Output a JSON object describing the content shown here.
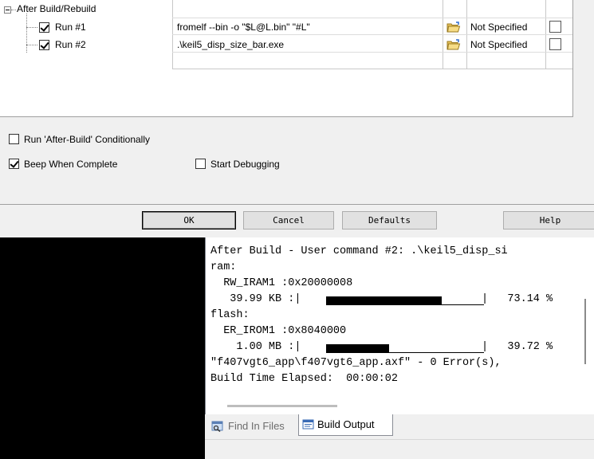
{
  "tree": {
    "group_label": "After Build/Rebuild",
    "rows": [
      {
        "label": "Run #1",
        "checked": true,
        "command": "fromelf --bin -o \"$L@L.bin\" \"#L\"",
        "dos16": "Not Specified"
      },
      {
        "label": "Run #2",
        "checked": true,
        "command": ".\\keil5_disp_size_bar.exe",
        "dos16": "Not Specified"
      }
    ]
  },
  "options": {
    "run_conditionally": "Run 'After-Build' Conditionally",
    "beep_when_complete": "Beep When Complete",
    "start_debugging": "Start Debugging"
  },
  "buttons": {
    "ok": "OK",
    "cancel": "Cancel",
    "defaults": "Defaults",
    "help": "Help"
  },
  "build_output": {
    "lines": [
      "After Build - User command #2: .\\keil5_disp_si",
      "ram:",
      "  RW_IRAM1 :0x20000008",
      "   39.99 KB :|",
      "flash:",
      "  ER_IROM1 :0x8040000",
      "    1.00 MB :|",
      "\"f407vgt6_app\\f407vgt6_app.axf\" - 0 Error(s),",
      "Build Time Elapsed:  00:00:02"
    ],
    "ram_percent": "|   73.14 %",
    "flash_percent": "|   39.72 %",
    "ram_usage": 73.14,
    "flash_usage": 39.72
  },
  "tabs": {
    "find_in_files": "Find In Files",
    "build_output": "Build Output"
  }
}
